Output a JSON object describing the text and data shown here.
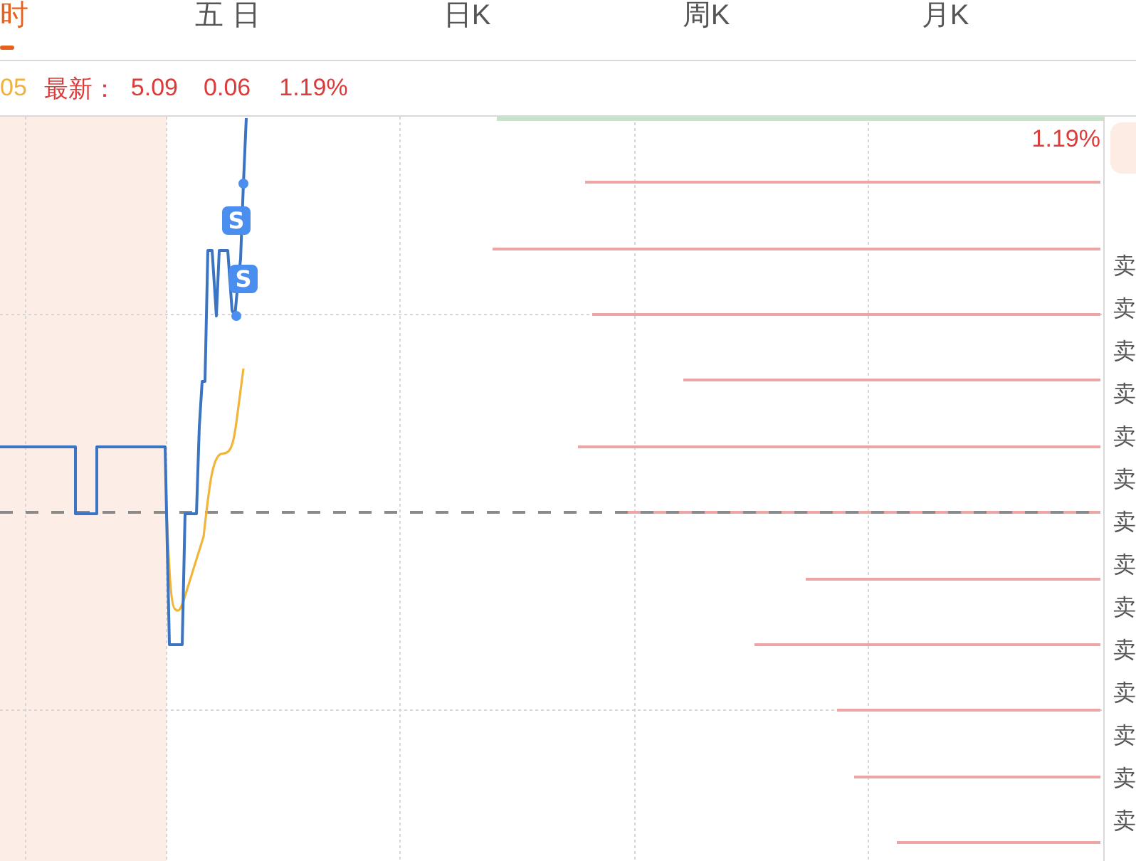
{
  "tabs": [
    {
      "label": "时",
      "selected": true
    },
    {
      "label": "五 日",
      "selected": false
    },
    {
      "label": "日K",
      "selected": false
    },
    {
      "label": "周K",
      "selected": false
    },
    {
      "label": "月K",
      "selected": false
    }
  ],
  "quote": {
    "average": "05",
    "latest_label": "最新：",
    "latest": "5.09",
    "change": "0.06",
    "change_percent": "1.19%"
  },
  "chart": {
    "top_label": "1.19%",
    "markers": [
      {
        "label": "S"
      },
      {
        "label": "S"
      }
    ]
  },
  "order_book": {
    "labels": [
      "卖",
      "卖",
      "卖",
      "卖",
      "卖",
      "卖",
      "卖",
      "卖",
      "卖",
      "卖",
      "卖",
      "卖",
      "卖",
      "卖"
    ]
  }
}
